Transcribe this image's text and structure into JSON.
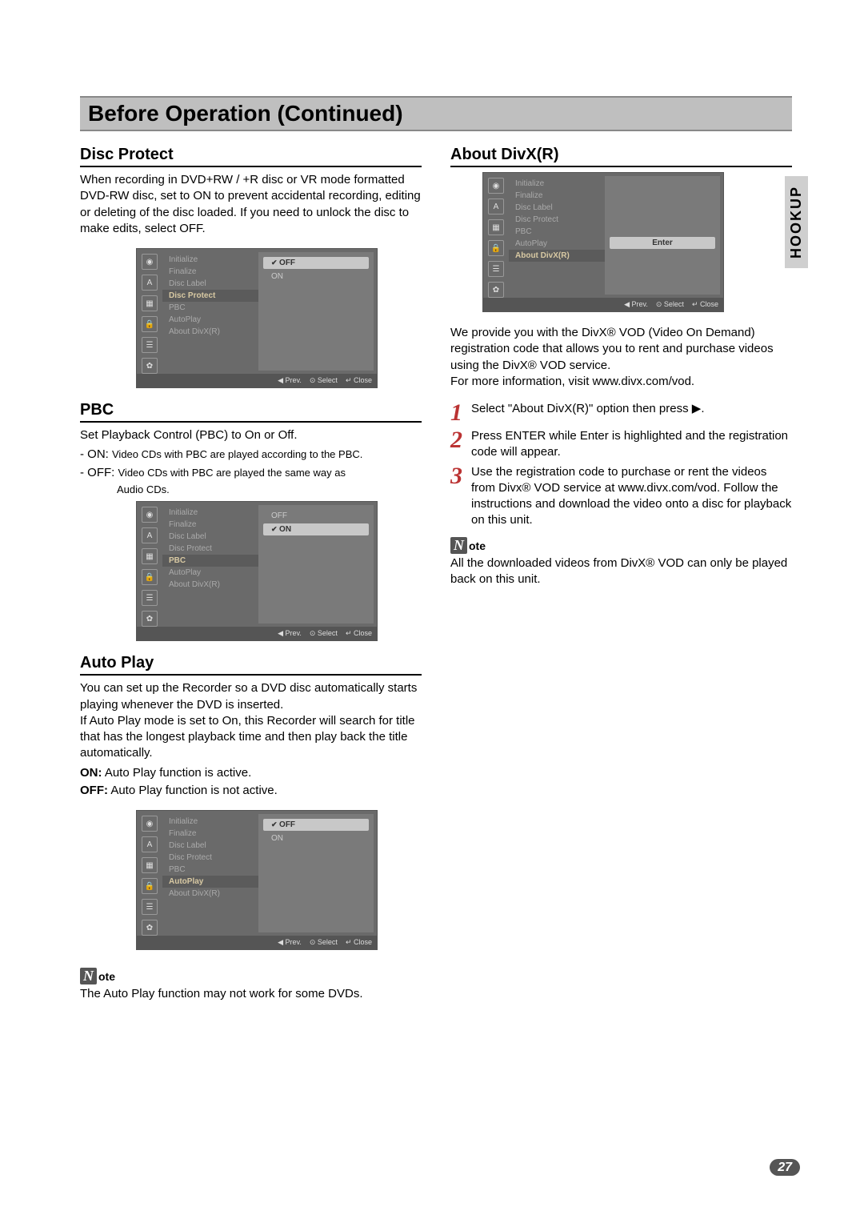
{
  "header": {
    "title": "Before Operation (Continued)"
  },
  "side_tab": "HOOKUP",
  "page_number": "27",
  "sections": {
    "disc_protect": {
      "heading": "Disc Protect",
      "body": "When recording in DVD+RW / +R disc or VR mode formatted DVD-RW disc, set to ON to prevent accidental recording, editing or deleting of the disc loaded. If you need to unlock the disc to make edits, select OFF."
    },
    "pbc": {
      "heading": "PBC",
      "intro": "Set Playback Control (PBC) to On or Off.",
      "lines": {
        "on_prefix": "- ON: ",
        "on": "Video CDs with PBC are played according to the PBC.",
        "off_prefix": "- OFF: ",
        "off_line1": "Video CDs with PBC are played the same way as",
        "off_line2": "Audio CDs."
      }
    },
    "auto_play": {
      "heading": "Auto Play",
      "body": "You can set up the Recorder so a DVD disc automatically starts playing whenever the DVD is inserted.\nIf Auto Play mode is set to On, this Recorder will search for title that has the longest playback time and then play back the title automatically.",
      "on_label": "ON:",
      "on_text": " Auto Play function is active.",
      "off_label": "OFF:",
      "off_text": " Auto Play function is not active.",
      "note": "The Auto Play function may not work for some DVDs."
    },
    "about_divx": {
      "heading": "About DivX(R)",
      "body": "We provide you with the DivX® VOD (Video On Demand) registration code that allows you to rent and purchase videos using the DivX® VOD service.\nFor more information, visit www.divx.com/vod.",
      "steps": {
        "s1": "Select \"About DivX(R)\" option then press ▶.",
        "s2": "Press ENTER while Enter is highlighted and the registration code will appear.",
        "s3": "Use the registration code to purchase or rent the videos from Divx® VOD service at www.divx.com/vod. Follow the instructions and download the video onto a disc for playback on this unit."
      },
      "note": "All the downloaded videos from DivX® VOD can only be played back on this unit."
    }
  },
  "note_label": {
    "icon": "N",
    "suffix": "ote"
  },
  "osd_common": {
    "items": {
      "initialize": "Initialize",
      "finalize": "Finalize",
      "disc_label": "Disc Label",
      "disc_protect": "Disc Protect",
      "pbc": "PBC",
      "autoplay": "AutoPlay",
      "about_divx": "About DivX(R)"
    },
    "options": {
      "off": "OFF",
      "on": "ON",
      "enter": "Enter"
    },
    "footer": {
      "prev": "◀ Prev.",
      "select": "⊙ Select",
      "close": "↵ Close"
    },
    "icons": {
      "disc": "◉",
      "a": "A",
      "chip": "▦",
      "lock": "🔒",
      "list": "☰",
      "gear": "✿"
    }
  }
}
